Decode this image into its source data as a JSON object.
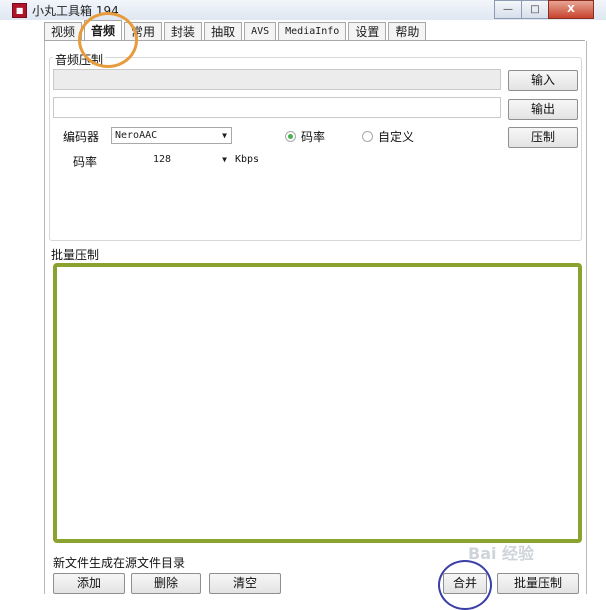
{
  "window": {
    "title": "小丸工具箱 194",
    "app_icon": "app-icon",
    "min": "—",
    "max": "□",
    "close": "X"
  },
  "tabs": [
    {
      "label": "视频"
    },
    {
      "label": "音频"
    },
    {
      "label": "常用"
    },
    {
      "label": "封装"
    },
    {
      "label": "抽取"
    },
    {
      "label": "AVS"
    },
    {
      "label": "MediaInfo"
    },
    {
      "label": "设置"
    },
    {
      "label": "帮助"
    }
  ],
  "audio": {
    "group_label": "音频压制",
    "input_button": "输入",
    "output_button": "输出",
    "encoder_label": "编码器",
    "encoder_value": "NeroAAC",
    "bitrate_radio": "码率",
    "custom_radio": "自定义",
    "compress_button": "压制",
    "bitrate_label": "码率",
    "bitrate_value": "128",
    "bitrate_unit": "Kbps"
  },
  "batch": {
    "group_label": "批量压制",
    "note": "新文件生成在源文件目录",
    "add_button": "添加",
    "delete_button": "删除",
    "clear_button": "清空",
    "merge_button": "合并",
    "batch_button": "批量压制"
  },
  "watermark": "Bai 经验",
  "colors": {
    "highlight_green": "#8aa32e",
    "highlight_orange": "#e79b3c",
    "highlight_blue": "#3b3fa8"
  }
}
